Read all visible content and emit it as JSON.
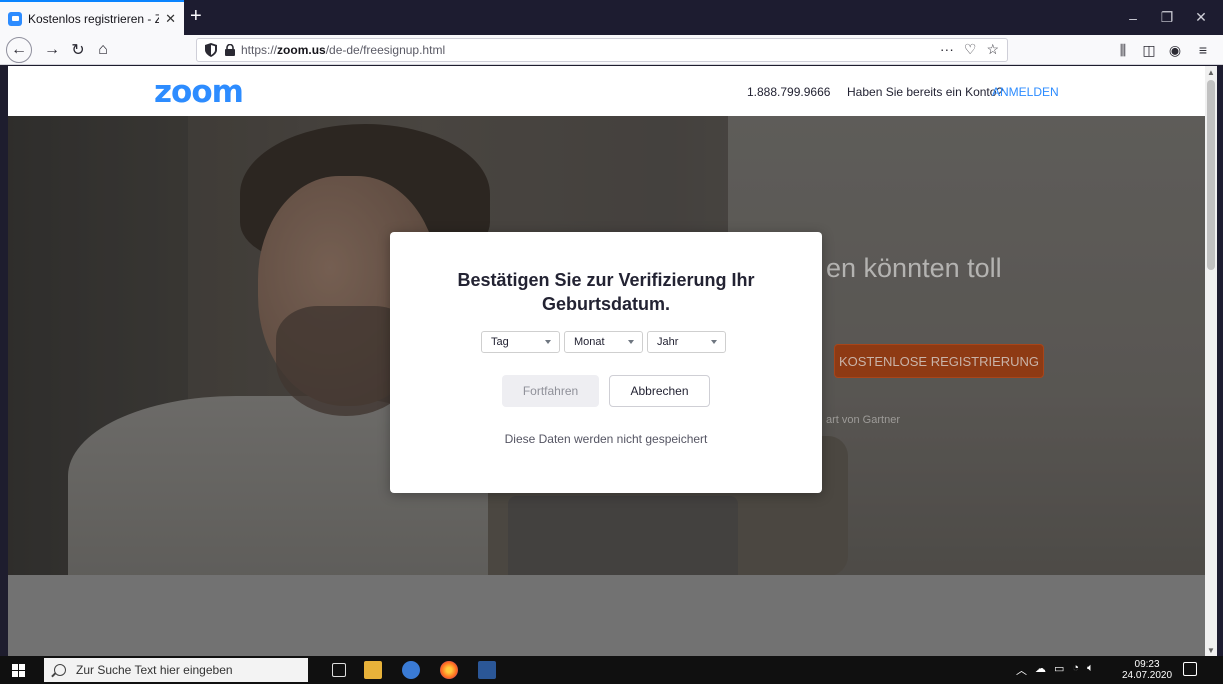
{
  "browser": {
    "tab_title": "Kostenlos registrieren - Zoom",
    "tab_close": "✕",
    "new_tab": "+",
    "url_prefix": "https://",
    "url_domain": "zoom.us",
    "url_path": "/de-de/freesignup.html",
    "page_actions": "···",
    "window_controls": {
      "minimize": "–",
      "restore": "❐",
      "close": "✕"
    }
  },
  "zoom_header": {
    "logo": "zoom",
    "phone": "1.888.799.9666",
    "have_account": "Haben Sie bereits ein Konto?",
    "signin": "ANMELDEN"
  },
  "hero": {
    "heading_fragment": "en könnten toll",
    "cta": "KOSTENLOSE REGISTRIERUNG",
    "note_fragment": "art von Gartner"
  },
  "modal": {
    "title_line1": "Bestätigen Sie zur Verifizierung Ihr",
    "title_line2": "Geburtsdatum.",
    "select_day": "Tag",
    "select_month": "Monat",
    "select_year": "Jahr",
    "continue_button": "Fortfahren",
    "cancel_button": "Abbrechen",
    "note": "Diese Daten werden nicht gespeichert"
  },
  "taskbar": {
    "search_placeholder": "Zur Suche Text hier eingeben",
    "clock_time": "09:23",
    "clock_date": "24.07.2020"
  },
  "colors": {
    "zoom_blue": "#2d8cff",
    "cta_orange": "#8e3a14",
    "browser_dark": "#1d1c30"
  },
  "icons": [
    "back-icon",
    "forward-icon",
    "reload-icon",
    "home-icon",
    "shield-icon",
    "lock-icon",
    "bookmark-star-icon",
    "pocket-icon",
    "library-icon",
    "sidebar-icon",
    "account-icon",
    "menu-icon"
  ]
}
